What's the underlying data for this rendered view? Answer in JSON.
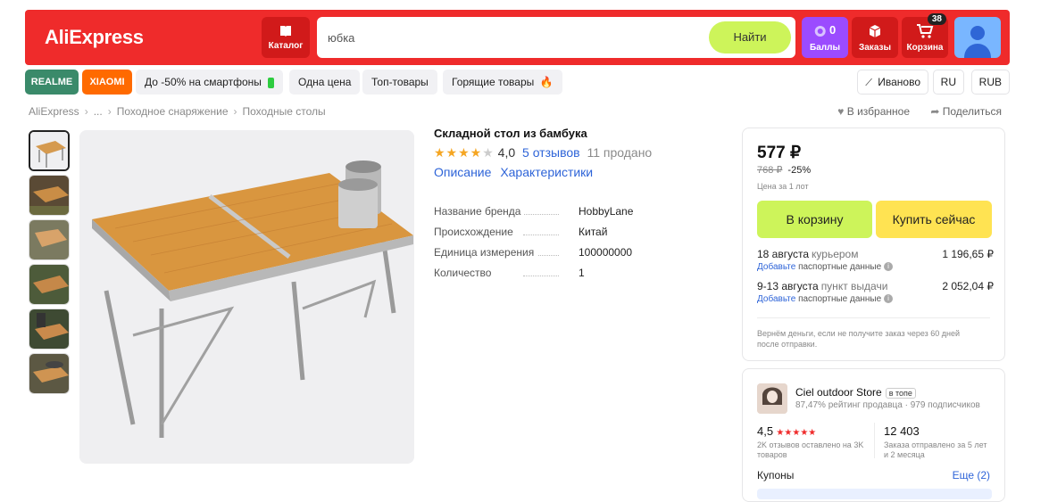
{
  "header": {
    "logo": "AliExpress",
    "catalog_label": "Каталог",
    "search": {
      "value": "юбка",
      "button": "Найти"
    },
    "points": {
      "count": "0",
      "label": "Баллы"
    },
    "orders_label": "Заказы",
    "cart": {
      "label": "Корзина",
      "badge": "38"
    },
    "colors": {
      "bar": "#ef2b2b",
      "points": "#9b4bff",
      "search_button": "#cdf45a"
    }
  },
  "promo_chips": [
    "REALME",
    "XIAOMI",
    "До -50% на смартфоны",
    "Одна цена",
    "Топ-товары",
    "Горящие товары"
  ],
  "location": {
    "city": "Иваново",
    "lang": "RU",
    "currency": "RUB"
  },
  "breadcrumb": [
    "AliExpress",
    "...",
    "Походное снаряжение",
    "Походные столы"
  ],
  "actions": {
    "favorite": "В избранное",
    "share": "Поделиться"
  },
  "product": {
    "title": "Складной стол из бамбука",
    "rating": "4,0",
    "rating_stars": 4,
    "reviews": "5 отзывов",
    "sold": "11 продано",
    "tabs": [
      "Описание",
      "Характеристики"
    ],
    "specs": [
      {
        "key": "Название бренда",
        "value": "HobbyLane"
      },
      {
        "key": "Происхождение",
        "value": "Китай"
      },
      {
        "key": "Единица измерения",
        "value": "100000000"
      },
      {
        "key": "Количество",
        "value": "1"
      }
    ]
  },
  "buy": {
    "price": "577 ₽",
    "old_price": "768 ₽",
    "discount": "-25%",
    "lot_note": "Цена за 1 лот",
    "cart_button": "В корзину",
    "buy_button": "Купить сейчас",
    "delivery": [
      {
        "when": "18 августа",
        "how": "курьером",
        "cost": "1 196,65 ₽",
        "add_link": "Добавьте",
        "note": "паспортные данные"
      },
      {
        "when": "9-13 августа",
        "how": "пункт выдачи",
        "cost": "2 052,04 ₽",
        "add_link": "Добавьте",
        "note": "паспортные данные"
      }
    ],
    "refund_note": "Вернём деньги, если не получите заказ через 60 дней после отправки."
  },
  "store": {
    "name": "Ciel outdoor Store",
    "tag": "в топе",
    "sub": "87,47% рейтинг продавца · 979 подписчиков",
    "rating": "4,5",
    "rating_stars": "★★★★★",
    "rating_note": "2K отзывов оставлено на 3K товаров",
    "shipped": "12 403",
    "shipped_note": "Заказа отправлено за 5 лет и 2 месяца",
    "coupons": "Купоны",
    "more": "Еще (2)"
  }
}
